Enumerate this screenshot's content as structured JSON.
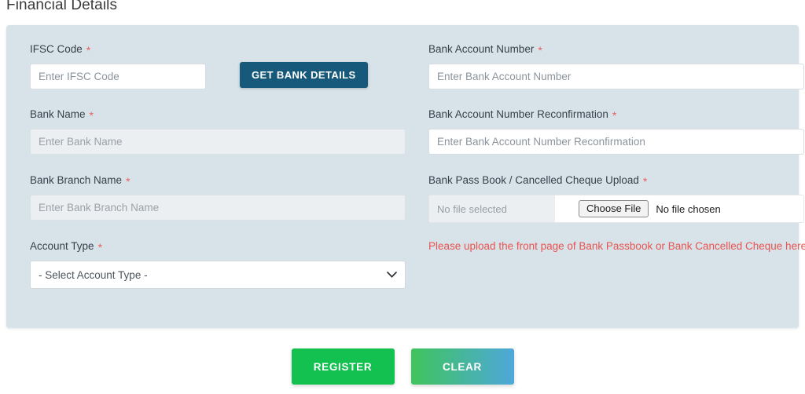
{
  "section": {
    "title": "Financial Details"
  },
  "left_column": {
    "ifsc": {
      "label": "IFSC Code",
      "required_mark": "*",
      "placeholder": "Enter IFSC Code",
      "value": ""
    },
    "get_bank_details_button": "GET BANK DETAILS",
    "bank_name": {
      "label": "Bank Name",
      "required_mark": "*",
      "placeholder": "Enter Bank Name",
      "value": ""
    },
    "bank_branch_name": {
      "label": "Bank Branch Name",
      "required_mark": "*",
      "placeholder": "Enter Bank Branch Name",
      "value": ""
    },
    "account_type": {
      "label": "Account Type",
      "required_mark": "*",
      "selected": "- Select Account Type -",
      "options": [
        "- Select Account Type -"
      ]
    }
  },
  "right_column": {
    "account_number": {
      "label": "Bank Account Number",
      "required_mark": "*",
      "placeholder": "Enter Bank Account Number",
      "value": ""
    },
    "account_number_reconfirm": {
      "label": "Bank Account Number Reconfirmation",
      "required_mark": "*",
      "placeholder": "Enter Bank Account Number Reconfirmation",
      "value": ""
    },
    "passbook_upload": {
      "label": "Bank Pass Book / Cancelled Cheque Upload",
      "required_mark": "*",
      "file_name_display": "No file selected",
      "choose_file_button": "Choose File",
      "chosen_status": "No file chosen",
      "hint": "Please upload the front page of Bank Passbook or Bank Cancelled Cheque here"
    }
  },
  "footer": {
    "register_label": "REGISTER",
    "clear_label": "CLEAR"
  },
  "colors": {
    "panel_background": "#d8e3e9",
    "get_bank_details": "#17597a",
    "register_green": "#12c150",
    "clear_gradient_start": "#3fc45c",
    "clear_gradient_end": "#4ea8da",
    "required_red": "#e8615c",
    "hint_red": "#e8534f",
    "page_background": "#ffffff"
  }
}
